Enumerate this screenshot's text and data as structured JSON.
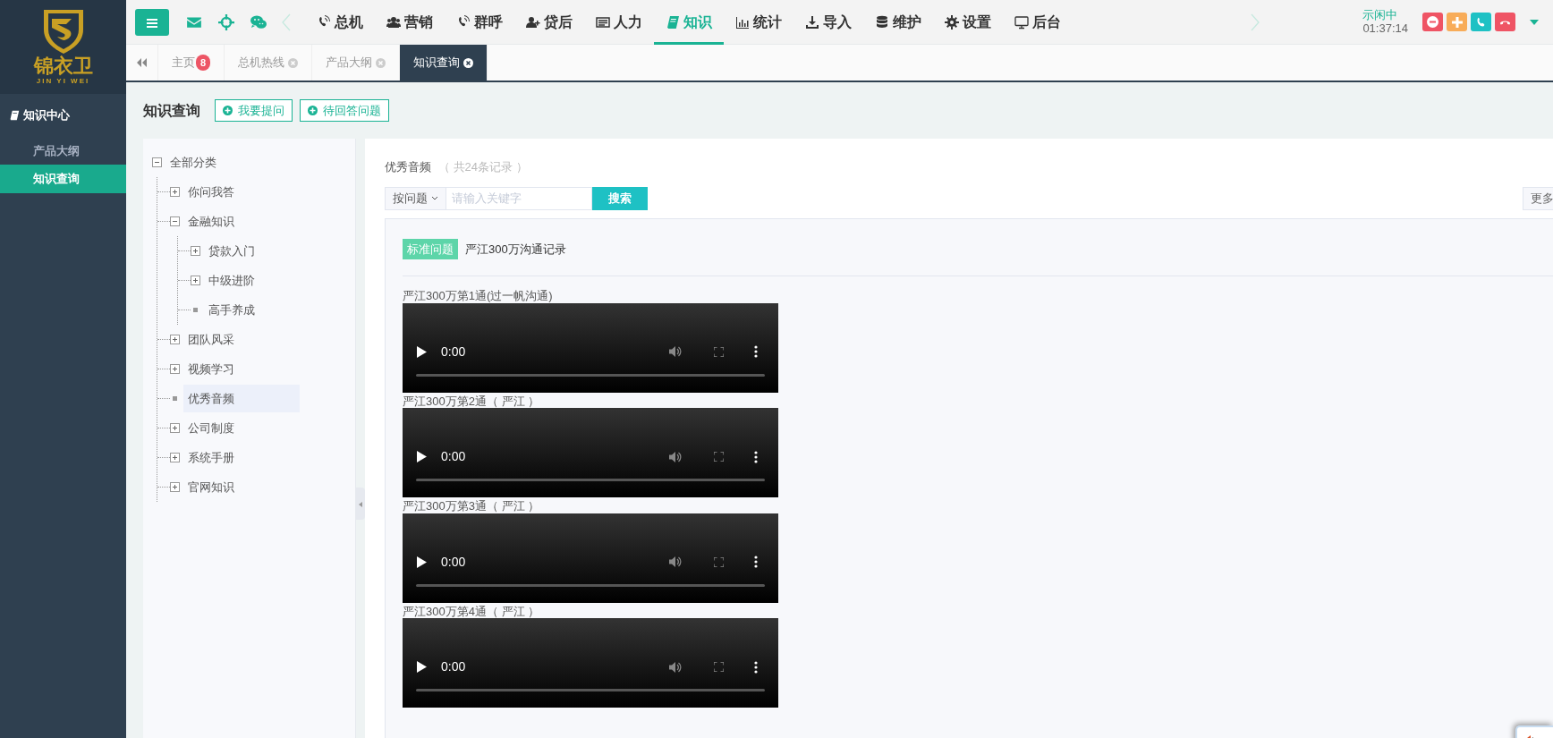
{
  "logo": {
    "name": "锦衣卫",
    "subtitle": "JIN YI WEI"
  },
  "sidebar": {
    "section": "知识中心",
    "items": [
      {
        "label": "产品大纲",
        "selected": false
      },
      {
        "label": "知识查询",
        "selected": true
      }
    ]
  },
  "top_nav": {
    "quick_icons": [
      {
        "kind": "mail"
      },
      {
        "kind": "target"
      },
      {
        "kind": "wechat"
      }
    ],
    "items": [
      {
        "label": "总机",
        "kind": "phone",
        "selected": false
      },
      {
        "label": "营销",
        "kind": "users",
        "selected": false
      },
      {
        "label": "群呼",
        "kind": "phone",
        "selected": false
      },
      {
        "label": "贷后",
        "kind": "userplus",
        "selected": false
      },
      {
        "label": "人力",
        "kind": "card",
        "selected": false
      },
      {
        "label": "知识",
        "kind": "book",
        "selected": true
      },
      {
        "label": "统计",
        "kind": "chart",
        "selected": false
      },
      {
        "label": "导入",
        "kind": "download",
        "selected": false
      },
      {
        "label": "维护",
        "kind": "database",
        "selected": false
      },
      {
        "label": "设置",
        "kind": "gear",
        "selected": false
      },
      {
        "label": "后台",
        "kind": "monitor",
        "selected": false
      }
    ],
    "status": "示闲中",
    "time": "01:37:14",
    "call_buttons": [
      {
        "kind": "minus",
        "color": "#ef5464"
      },
      {
        "kind": "plus",
        "color": "#f8ac59"
      },
      {
        "kind": "phone",
        "color": "#1ec1c4"
      },
      {
        "kind": "hangup",
        "color": "#ef5464"
      }
    ]
  },
  "tabs": [
    {
      "label": "主页",
      "badge": "8",
      "closable": false,
      "selected": false
    },
    {
      "label": "总机热线",
      "closable": true,
      "selected": false
    },
    {
      "label": "产品大纲",
      "closable": true,
      "selected": false
    },
    {
      "label": "知识查询",
      "closable": true,
      "selected": true
    }
  ],
  "page": {
    "title": "知识查询",
    "buttons": [
      "我要提问",
      "待回答问题"
    ]
  },
  "tree": {
    "label": "全部分类",
    "kind": "folder",
    "expanded": true,
    "selected": false,
    "children": [
      {
        "label": "你问我答",
        "kind": "folder",
        "expanded": false,
        "selected": false
      },
      {
        "label": "金融知识",
        "kind": "folder",
        "expanded": true,
        "selected": false,
        "children": [
          {
            "label": "贷款入门",
            "kind": "folder",
            "expanded": false,
            "selected": false
          },
          {
            "label": "中级进阶",
            "kind": "folder",
            "expanded": false,
            "selected": false
          },
          {
            "label": "高手养成",
            "kind": "leaf",
            "selected": false
          }
        ]
      },
      {
        "label": "团队风采",
        "kind": "folder",
        "expanded": false,
        "selected": false
      },
      {
        "label": "视频学习",
        "kind": "folder",
        "expanded": false,
        "selected": false
      },
      {
        "label": "优秀音频",
        "kind": "leaf",
        "selected": true
      },
      {
        "label": "公司制度",
        "kind": "folder",
        "expanded": false,
        "selected": false
      },
      {
        "label": "系统手册",
        "kind": "folder",
        "expanded": false,
        "selected": false
      },
      {
        "label": "官网知识",
        "kind": "folder",
        "expanded": false,
        "selected": false
      }
    ]
  },
  "content": {
    "heading": "优秀音频",
    "count": "（ 共24条记录 ）",
    "search": {
      "mode": "按问题",
      "placeholder": "请输入关键字",
      "button": "搜索"
    },
    "more_button": "更多",
    "record": {
      "tag": "标准问题",
      "title": "严江300万沟通记录",
      "media": [
        {
          "label": "严江300万第1通(过一帆沟通)",
          "time": "0:00"
        },
        {
          "label": "严江300万第2通（ 严江 ）",
          "time": "0:00"
        },
        {
          "label": "严江300万第3通（ 严江 ）",
          "time": "0:00"
        },
        {
          "label": "严江300万第4通（ 严江 ）",
          "time": "0:00"
        }
      ]
    }
  }
}
